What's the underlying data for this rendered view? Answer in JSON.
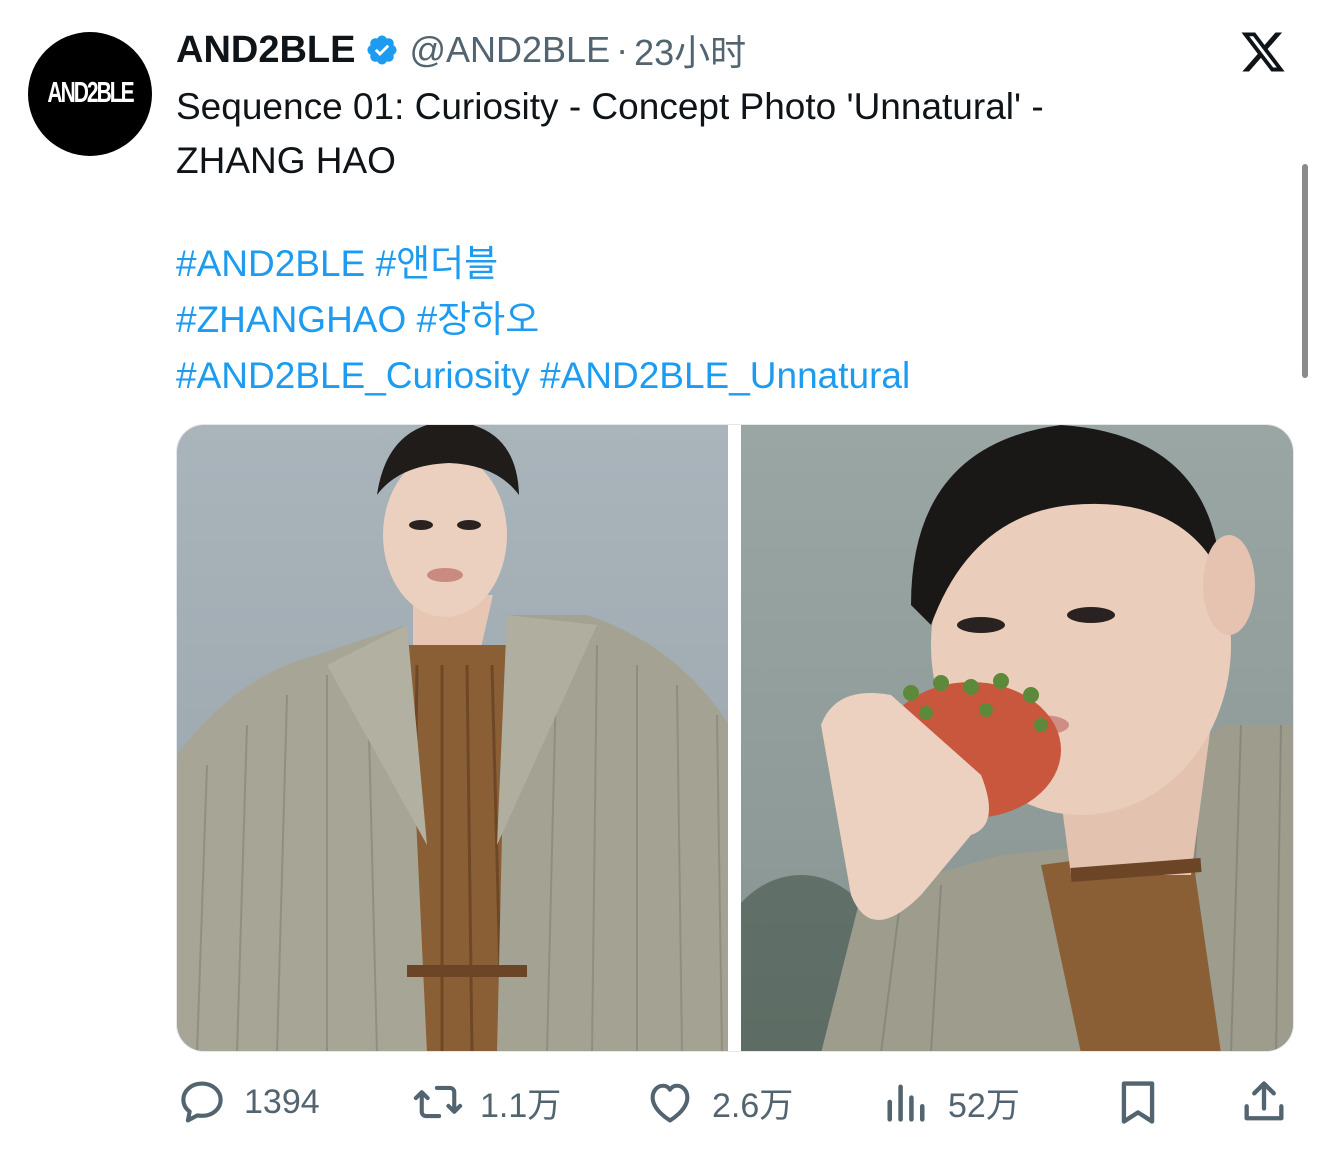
{
  "account": {
    "display_name": "AND2BLE",
    "avatar_text": "AND2BLE",
    "handle": "@AND2BLE",
    "separator": "·",
    "timestamp": "23小时",
    "verified": true
  },
  "tweet": {
    "text_lines": [
      "Sequence 01: Curiosity - Concept Photo 'Unnatural' -",
      "ZHANG HAO"
    ],
    "hashtag_lines": [
      [
        "#AND2BLE",
        "#앤더블"
      ],
      [
        "#ZHANGHAO",
        "#장하오"
      ],
      [
        "#AND2BLE_Curiosity",
        "#AND2BLE_Unnatural"
      ]
    ]
  },
  "actions": {
    "replies": "1394",
    "retweets": "1.1万",
    "likes": "2.6万",
    "views": "52万"
  },
  "icons": {
    "platform": "x-logo-icon",
    "verified": "verified-badge-icon",
    "reply": "reply-icon",
    "retweet": "retweet-icon",
    "like": "heart-icon",
    "views": "views-chart-icon",
    "bookmark": "bookmark-icon",
    "share": "share-icon"
  },
  "colors": {
    "link": "#1d9bf0",
    "muted": "#536471",
    "text": "#0f1419",
    "background": "#ffffff"
  }
}
